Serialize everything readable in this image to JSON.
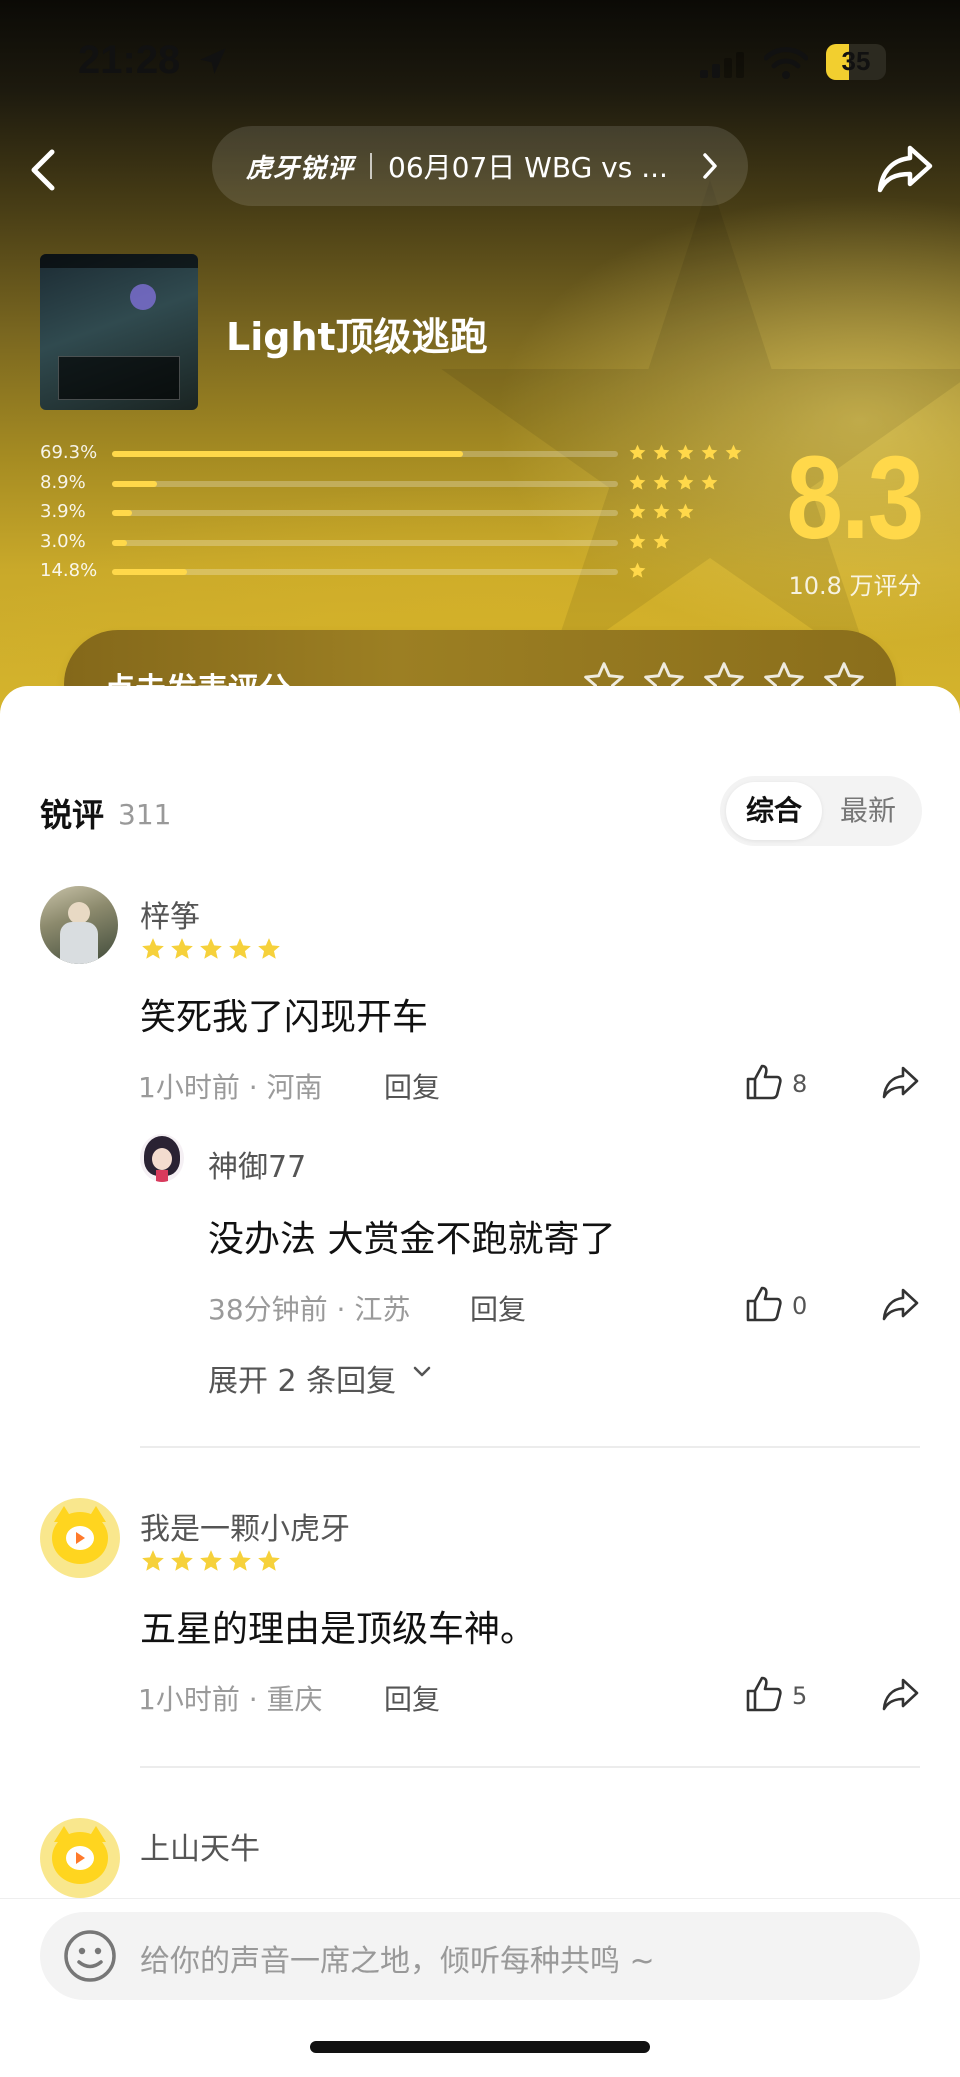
{
  "status_bar": {
    "time": "21:28",
    "battery": "35"
  },
  "nav": {
    "brand": "虎牙锐评",
    "match_title": "06月07日 WBG vs ..."
  },
  "video": {
    "title": "Light顶级逃跑"
  },
  "rating": {
    "score": "8.3",
    "count_label": "10.8 万评分",
    "distribution": [
      {
        "stars": 5,
        "label": "69.3%",
        "percent": 69.3
      },
      {
        "stars": 4,
        "label": "8.9%",
        "percent": 8.9
      },
      {
        "stars": 3,
        "label": "3.9%",
        "percent": 3.9
      },
      {
        "stars": 2,
        "label": "3.0%",
        "percent": 3.0
      },
      {
        "stars": 1,
        "label": "14.8%",
        "percent": 14.8
      }
    ],
    "rate_prompt": "点击发表评分"
  },
  "reviews": {
    "title": "锐评",
    "count": "311",
    "sort_options": [
      "综合",
      "最新"
    ],
    "active_sort": "综合"
  },
  "comments": [
    {
      "username": "梓筝",
      "stars": 5,
      "text": "笑死我了闪现开车",
      "time_location": "1小时前 · 河南",
      "reply_label": "回复",
      "likes": "8",
      "reply": {
        "username": "神御77",
        "text": "没办法 大赏金不跑就寄了",
        "time_location": "38分钟前 · 江苏",
        "reply_label": "回复",
        "likes": "0"
      },
      "expand_label": "展开 2 条回复"
    },
    {
      "username": "我是一颗小虎牙",
      "stars": 5,
      "text": "五星的理由是顶级车神。",
      "time_location": "1小时前 · 重庆",
      "reply_label": "回复",
      "likes": "5"
    },
    {
      "username": "上山天牛"
    }
  ],
  "input": {
    "placeholder": "给你的声音一席之地，倾听每种共鸣 ~"
  },
  "colors": {
    "accent_gold": "#ffd84a",
    "star_yellow": "#f6d13b"
  },
  "icons": [
    "back-icon",
    "chevron-right-icon",
    "share-icon",
    "star-icon",
    "star-outline-icon",
    "thumb-up-icon",
    "chevron-down-icon",
    "emoji-icon",
    "location-arrow-icon",
    "wifi-icon",
    "signal-icon"
  ]
}
